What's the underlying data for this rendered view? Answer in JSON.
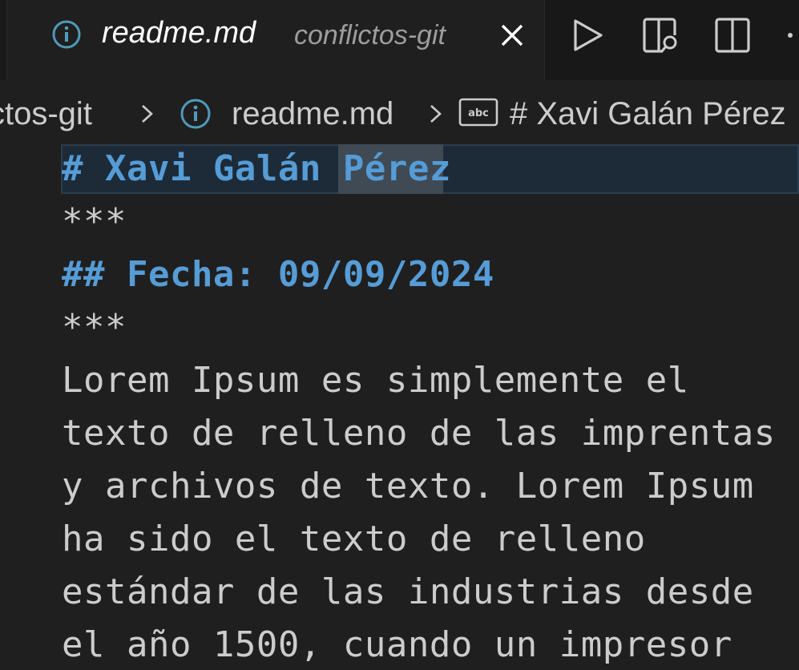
{
  "tab": {
    "title": "readme.md",
    "description": "conflictos-git"
  },
  "breadcrumbs": {
    "folder": "ctos-git",
    "file": "readme.md",
    "symbol": "# Xavi Galán Pérez"
  },
  "editor": {
    "lines": [
      "# Xavi Galán Pérez",
      "***",
      "## Fecha: 09/09/2024",
      "***",
      "Lorem Ipsum es simplemente el",
      "texto de relleno de las imprentas",
      "y archivos de texto. Lorem Ipsum",
      "ha sido el texto de relleno",
      "estándar de las industrias desde",
      "el año 1500, cuando un impresor"
    ]
  },
  "colors": {
    "heading": "#569cd6",
    "text": "#cccccc",
    "background": "#1f1f1f",
    "tabbar": "#181818",
    "current_line": "#1d2b38"
  },
  "icons": {
    "file_icon": "info-icon",
    "symbol_icon": "abc-symbol-icon",
    "close": "close-icon",
    "run": "play-icon",
    "preview": "open-preview-icon",
    "split": "split-editor-icon",
    "more": "more-actions-icon"
  }
}
